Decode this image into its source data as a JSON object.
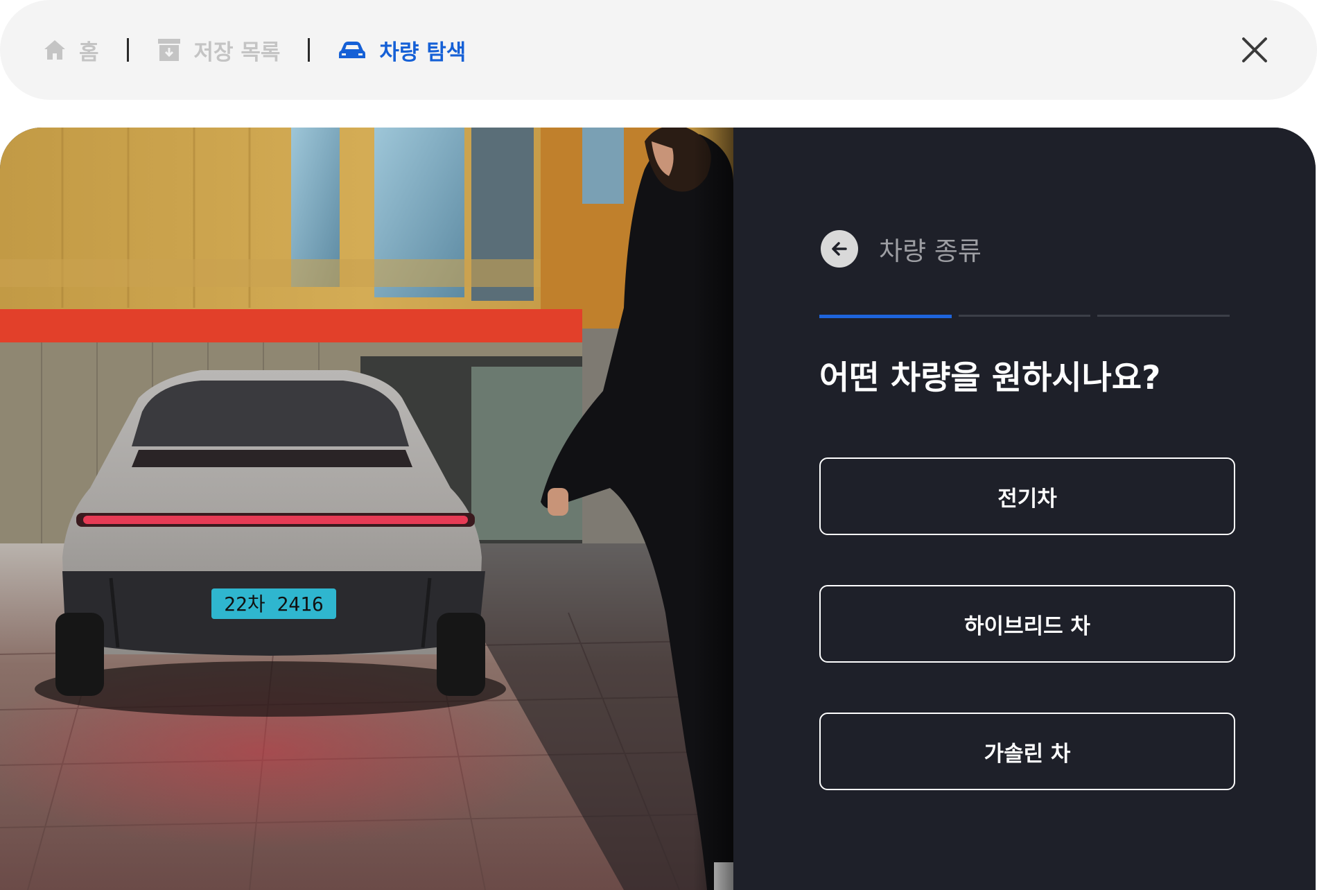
{
  "nav": {
    "home_label": "홈",
    "saved_label": "저장 목록",
    "search_label": "차량 탐색",
    "active_color": "#1560d6",
    "inactive_color": "#c4c4c4",
    "icons": [
      "home-icon",
      "archive-icon",
      "car-icon",
      "close-icon"
    ]
  },
  "photo": {
    "plate_text": "22차 2416",
    "description_icon": "vehicle-photo"
  },
  "side": {
    "step_title": "차량 종류",
    "progress": {
      "current_step": 1,
      "total_steps": 3
    },
    "question": "어떤 차량을 원하시나요?",
    "options": [
      {
        "label": "전기차"
      },
      {
        "label": "하이브리드 차"
      },
      {
        "label": "가솔린 차"
      }
    ],
    "accent_color": "#1e64dc",
    "background_color": "#1e2029"
  }
}
